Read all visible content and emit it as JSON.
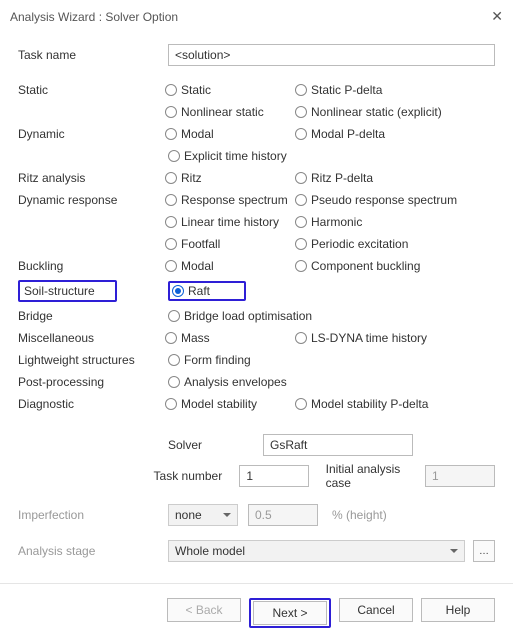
{
  "window": {
    "title": "Analysis Wizard : Solver Option"
  },
  "task_name": {
    "label": "Task name",
    "value": "<solution>"
  },
  "groups": {
    "static": {
      "label": "Static",
      "opts": [
        [
          "Static",
          "Static P-delta"
        ],
        [
          "Nonlinear static",
          "Nonlinear static (explicit)"
        ]
      ]
    },
    "dynamic": {
      "label": "Dynamic",
      "opts": [
        [
          "Modal",
          "Modal P-delta"
        ],
        [
          "Explicit time history",
          ""
        ]
      ]
    },
    "ritz": {
      "label": "Ritz analysis",
      "opts": [
        [
          "Ritz",
          "Ritz P-delta"
        ]
      ]
    },
    "dynresp": {
      "label": "Dynamic response",
      "opts": [
        [
          "Response spectrum",
          "Pseudo response spectrum"
        ],
        [
          "Linear time history",
          "Harmonic"
        ],
        [
          "Footfall",
          "Periodic excitation"
        ]
      ]
    },
    "buckling": {
      "label": "Buckling",
      "opts": [
        [
          "Modal",
          "Component buckling"
        ]
      ]
    },
    "soil": {
      "label": "Soil-structure",
      "opts": [
        [
          "Raft",
          ""
        ]
      ]
    },
    "bridge": {
      "label": "Bridge",
      "opts": [
        [
          "Bridge load optimisation",
          ""
        ]
      ]
    },
    "misc": {
      "label": "Miscellaneous",
      "opts": [
        [
          "Mass",
          "LS-DYNA time history"
        ]
      ]
    },
    "light": {
      "label": "Lightweight structures",
      "opts": [
        [
          "Form finding",
          ""
        ]
      ]
    },
    "post": {
      "label": "Post-processing",
      "opts": [
        [
          "Analysis envelopes",
          ""
        ]
      ]
    },
    "diag": {
      "label": "Diagnostic",
      "opts": [
        [
          "Model stability",
          "Model stability P-delta"
        ]
      ]
    }
  },
  "solver": {
    "label": "Solver",
    "value": "GsRaft"
  },
  "task_number": {
    "label": "Task number",
    "value": "1"
  },
  "initial_case": {
    "label": "Initial analysis case",
    "value": "1"
  },
  "imperfection": {
    "label": "Imperfection",
    "select": "none",
    "value": "0.5",
    "unit": "% (height)"
  },
  "analysis_stage": {
    "label": "Analysis stage",
    "value": "Whole model"
  },
  "buttons": {
    "back": "< Back",
    "next": "Next >",
    "cancel": "Cancel",
    "help": "Help"
  }
}
